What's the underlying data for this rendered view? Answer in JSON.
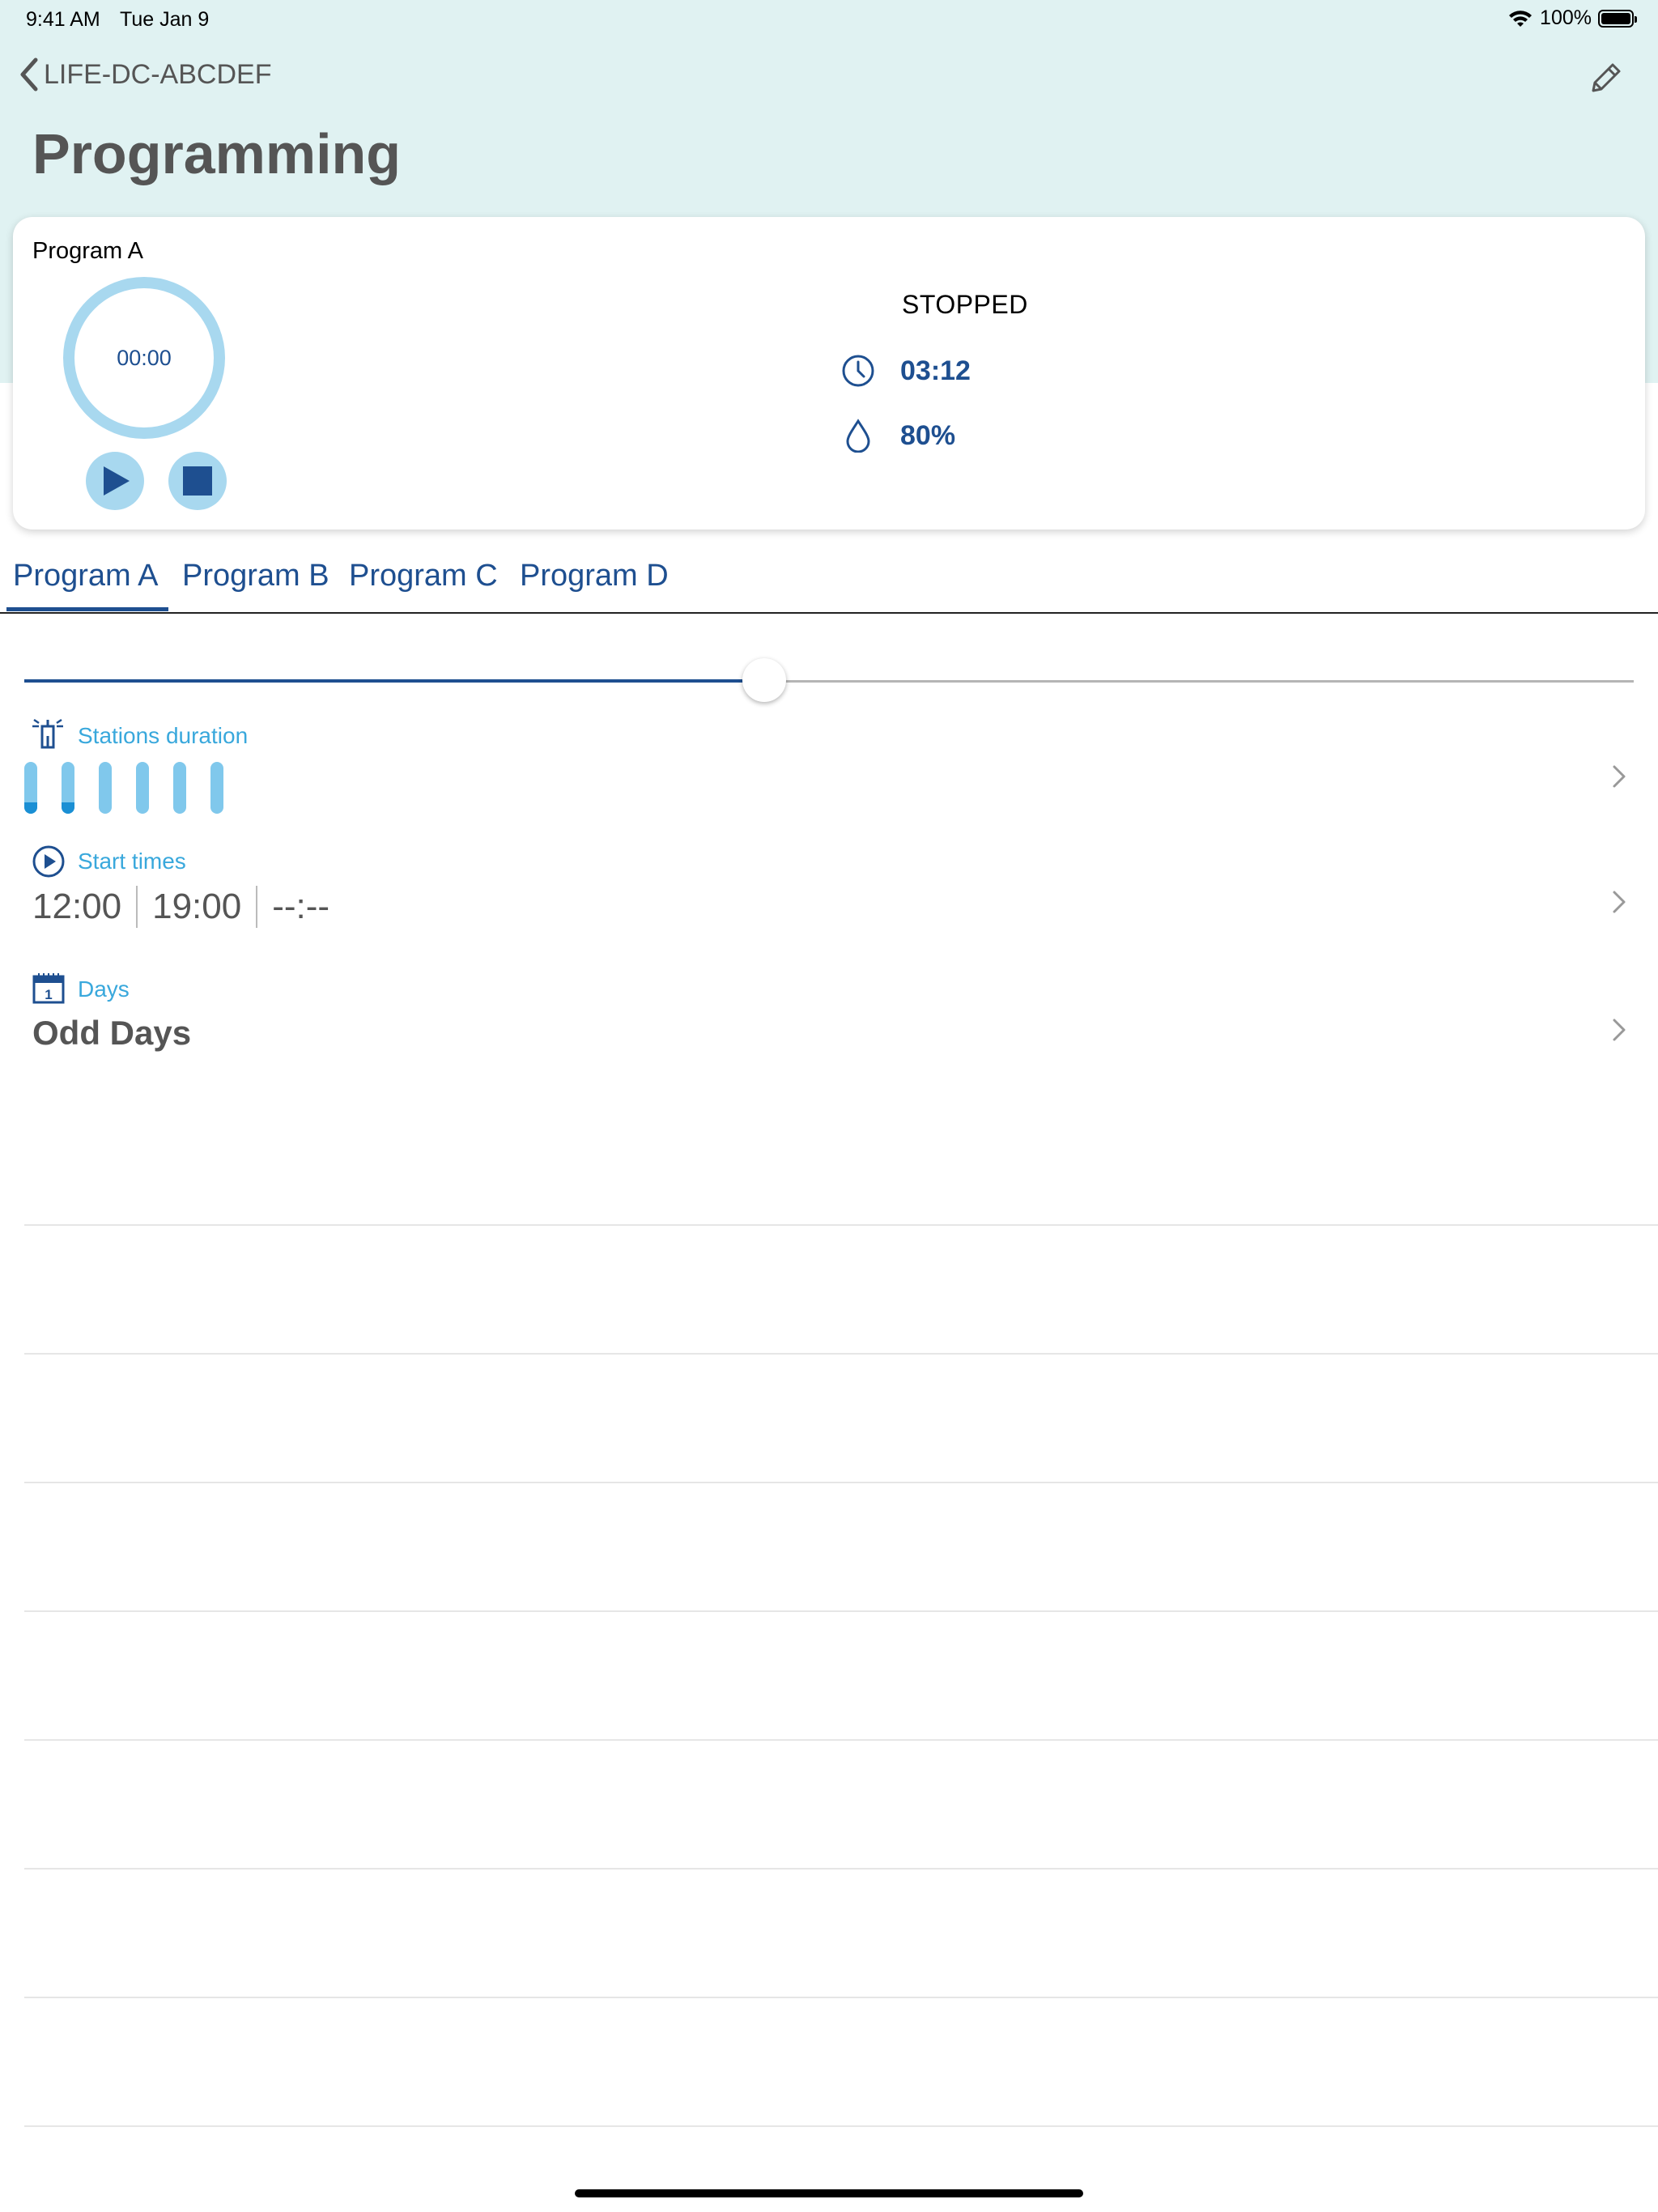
{
  "status_bar": {
    "time": "9:41 AM",
    "date": "Tue Jan 9",
    "battery": "100%"
  },
  "nav": {
    "back_label": "LIFE-DC-ABCDEF",
    "title": "Programming"
  },
  "program_card": {
    "name": "Program A",
    "timer": "00:00",
    "state": "STOPPED",
    "duration": "03:12",
    "water_budget": "80%"
  },
  "tabs": [
    {
      "label": "Program A",
      "selected": true
    },
    {
      "label": "Program B",
      "selected": false
    },
    {
      "label": "Program C",
      "selected": false
    },
    {
      "label": "Program D",
      "selected": false
    }
  ],
  "slider": {
    "value": 0.46
  },
  "stations": {
    "label": "Stations duration",
    "bars": [
      {
        "active": true
      },
      {
        "active": true
      },
      {
        "active": false
      },
      {
        "active": false
      },
      {
        "active": false
      },
      {
        "active": false
      }
    ]
  },
  "start_times": {
    "label": "Start times",
    "values": [
      "12:00",
      "19:00",
      "--:--"
    ]
  },
  "days": {
    "label": "Days",
    "value": "Odd Days",
    "icon_day": "1"
  },
  "colors": {
    "header_bg": "#e0f2f2",
    "primary": "#1e4f90",
    "accent": "#39a8dc",
    "ring": "#a8d8ef"
  }
}
